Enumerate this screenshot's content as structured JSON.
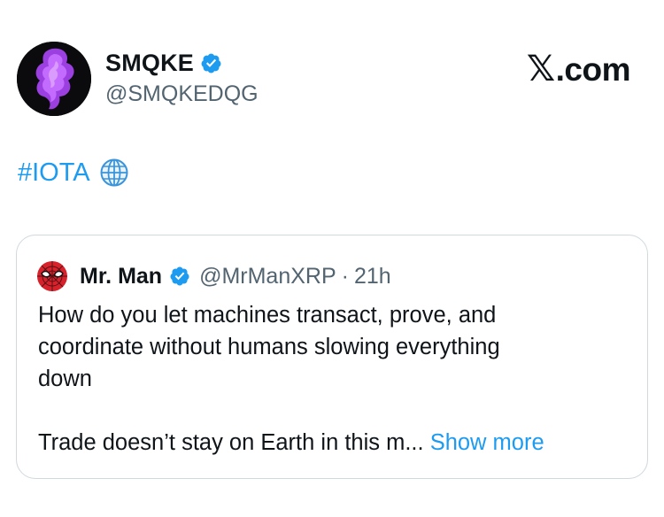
{
  "author": {
    "name": "SMQKE",
    "handle": "@SMQKEDQG",
    "verified": true
  },
  "site": {
    "logo_mark": "𝕏",
    "logo_text": ".com"
  },
  "tweet": {
    "hashtag": "#IOTA",
    "emoji_icon": "globe-icon"
  },
  "quote": {
    "name": "Mr. Man",
    "handle": "@MrManXRP",
    "separator": "·",
    "time": "21h",
    "lines": [
      "How do you let machines transact, prove, and",
      "coordinate without humans slowing everything",
      "down"
    ],
    "truncated_text": "Trade doesn’t stay on Earth in this m...",
    "show_more": "Show more"
  },
  "colors": {
    "accent": "#1d9bf0",
    "muted": "#536471",
    "text": "#0f1419",
    "border": "#cfd9de"
  }
}
